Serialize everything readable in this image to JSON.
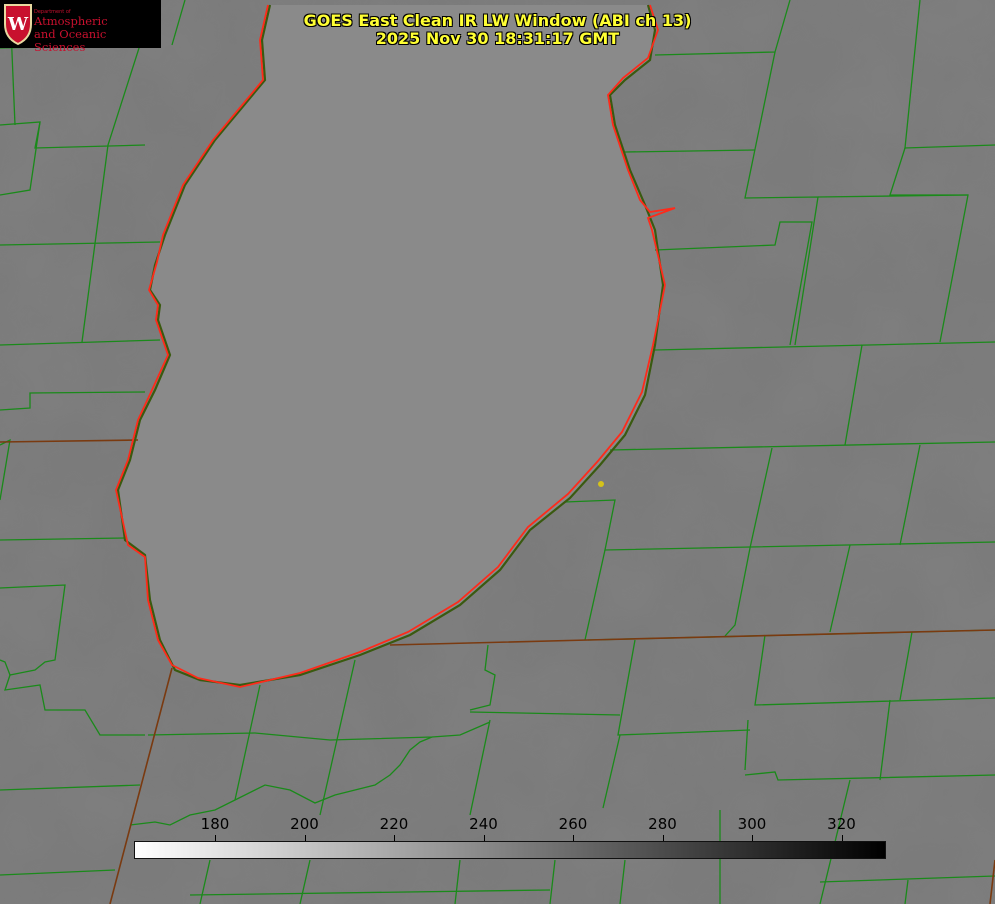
{
  "title": {
    "line1": "GOES East Clean IR LW Window (ABI ch 13)",
    "line2": "2025 Nov 30 18:31:17 GMT"
  },
  "logo": {
    "dept": "Department of",
    "line1": "Atmospheric",
    "line2": "and Oceanic Sciences",
    "color": "#c8102e"
  },
  "colorbar": {
    "ticks": [
      "180",
      "200",
      "220",
      "240",
      "260",
      "280",
      "300",
      "320"
    ]
  },
  "colors": {
    "boundary": "#1a8a1a",
    "coastline": "#ff2a1a",
    "title": "#ffff33",
    "marker": "#d4c21a"
  }
}
